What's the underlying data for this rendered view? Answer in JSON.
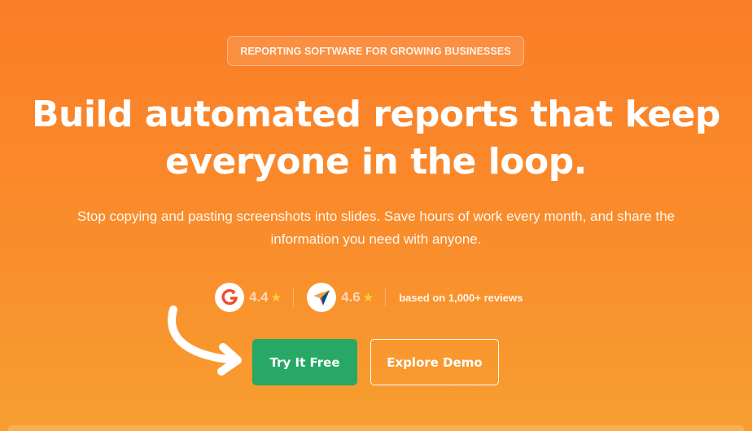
{
  "hero": {
    "badge": "REPORTING SOFTWARE FOR GROWING BUSINESSES",
    "headline_line1": "Build automated reports that keep",
    "headline_line2": "everyone in the loop.",
    "subtext_line1": "Stop copying and pasting screenshots into slides. Save hours of work every month, and share the",
    "subtext_line2": "information you need with anyone."
  },
  "ratings": {
    "g2": {
      "icon": "g2-logo-icon",
      "score": "4.4",
      "star": "★"
    },
    "capterra": {
      "icon": "capterra-logo-icon",
      "score": "4.6",
      "star": "★"
    },
    "reviews_text": "based on 1,000+ reviews"
  },
  "cta": {
    "primary_label": "Try It Free",
    "secondary_label": "Explore Demo"
  },
  "colors": {
    "background": "#fb7d27",
    "primary_button": "#27a866",
    "star": "#ffd23a"
  }
}
